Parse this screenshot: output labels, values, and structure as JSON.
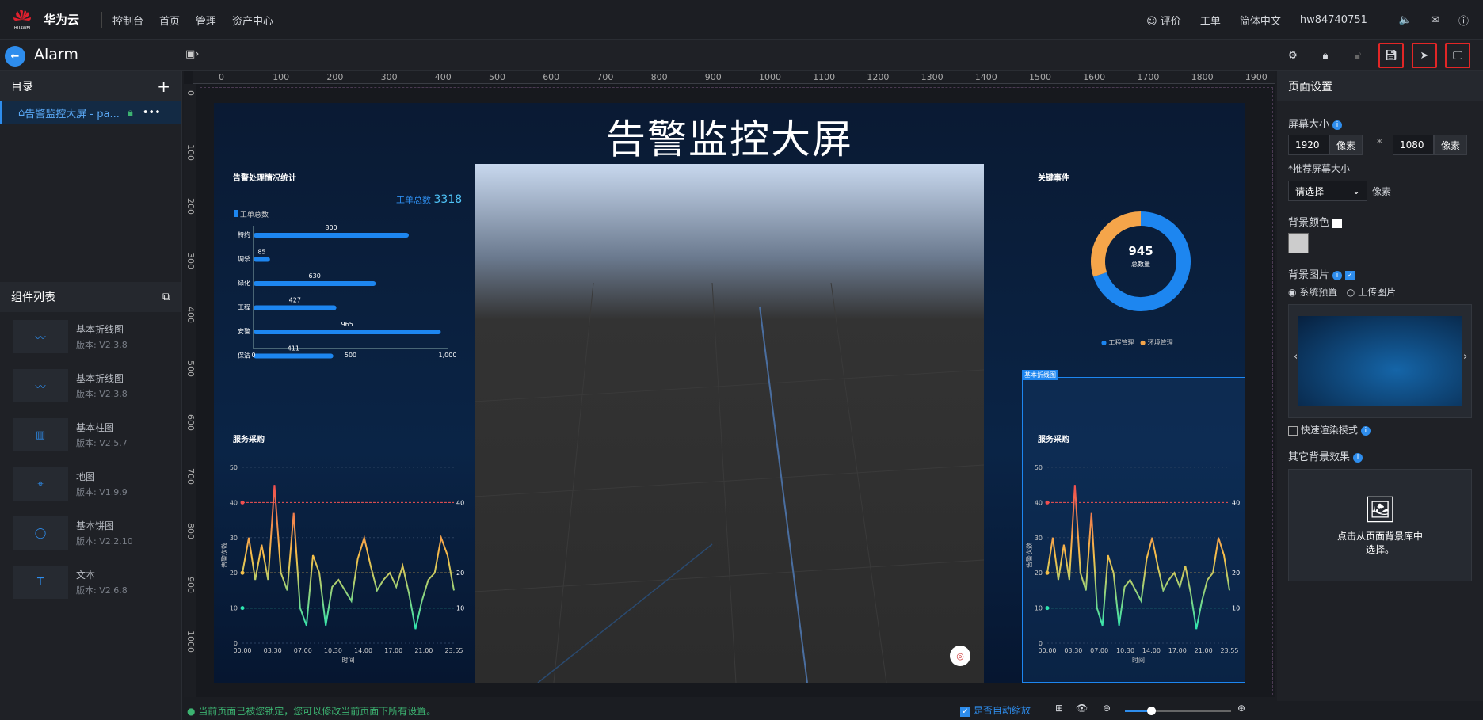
{
  "topbar": {
    "brand": "华为云",
    "nav": [
      "控制台",
      "首页",
      "管理",
      "资产中心"
    ],
    "feedback": "评价",
    "ticket": "工单",
    "language": "简体中文",
    "user": "hw84740751"
  },
  "secbar": {
    "title": "Alarm"
  },
  "left": {
    "catalog_title": "目录",
    "page_item": "告警监控大屏 - pa...",
    "components_title": "组件列表",
    "components": [
      {
        "name": "基本折线图",
        "version": "版本: V2.3.8",
        "icon": "line-chart-icon"
      },
      {
        "name": "基本折线图",
        "version": "版本: V2.3.8",
        "icon": "line-chart-icon"
      },
      {
        "name": "基本柱图",
        "version": "版本: V2.5.7",
        "icon": "bar-chart-icon"
      },
      {
        "name": "地图",
        "version": "版本: V1.9.9",
        "icon": "map-icon"
      },
      {
        "name": "基本饼图",
        "version": "版本: V2.2.10",
        "icon": "pie-chart-icon"
      },
      {
        "name": "文本",
        "version": "版本: V2.6.8",
        "icon": "text-icon"
      }
    ]
  },
  "ruler": {
    "h": [
      "0",
      "100",
      "200",
      "300",
      "400",
      "500",
      "600",
      "700",
      "800",
      "900",
      "1000",
      "1100",
      "1200",
      "1300",
      "1400",
      "1500",
      "1600",
      "1700",
      "1800",
      "1900"
    ],
    "v": [
      "0",
      "100",
      "200",
      "300",
      "400",
      "500",
      "600",
      "700",
      "800",
      "900",
      "1000"
    ]
  },
  "stage": {
    "title": "告警监控大屏",
    "bar_title": "告警处理情况统计",
    "total_label": "工单总数",
    "total_value": "3318",
    "legend": "工单总数",
    "key_events": "关键事件",
    "donut_value": "945",
    "donut_label": "总数量",
    "donut_legend": [
      "工程管理",
      "环境管理"
    ],
    "service_title": "服务采购",
    "service_title2": "服务采购",
    "line_ylabel": "告警次数",
    "line_xlabel": "时间",
    "selected_tag": "基本折线图"
  },
  "chart_data": [
    {
      "type": "bar",
      "title": "告警处理情况统计",
      "categories": [
        "特约",
        "调杀",
        "绿化",
        "工程",
        "安警",
        "保洁"
      ],
      "series": [
        {
          "name": "工单总数",
          "values": [
            800,
            85,
            630,
            427,
            965,
            411
          ]
        }
      ],
      "xlim": [
        0,
        1000
      ],
      "xticks": [
        "0",
        "500",
        "1,000"
      ]
    },
    {
      "type": "pie",
      "title": "关键事件",
      "slices": [
        {
          "name": "工程管理",
          "value": 0.7
        },
        {
          "name": "环境管理",
          "value": 0.3
        }
      ],
      "colors": [
        "#1d86f0",
        "#f5a54a"
      ]
    },
    {
      "type": "line",
      "title": "服务采购",
      "ylim": [
        0,
        50
      ],
      "yticks": [
        "0",
        "10",
        "20",
        "30",
        "40",
        "50"
      ],
      "x": [
        "00:00",
        "03:30",
        "07:00",
        "10:30",
        "14:00",
        "17:00",
        "21:00",
        "23:55"
      ],
      "values": [
        20,
        30,
        18,
        28,
        18,
        45,
        20,
        15,
        37,
        10,
        5,
        25,
        20,
        5,
        16,
        18,
        15,
        12,
        24,
        30,
        22,
        15,
        18,
        20,
        16,
        22,
        14,
        4,
        12,
        18,
        20,
        30,
        25,
        15
      ],
      "markers": [
        "40",
        "20",
        "10"
      ]
    }
  ],
  "right": {
    "section": "页面设置",
    "screen_size": "屏幕大小",
    "width": "1920",
    "height": "1080",
    "unit": "像素",
    "recommend": "*推荐屏幕大小",
    "select": "请选择",
    "bg_color": "背景颜色",
    "bg_image": "背景图片",
    "preset": "系统预置",
    "upload": "上传图片",
    "fast_render": "快速渲染模式",
    "other_bg": "其它背景效果",
    "pick_hint": "点击从页面背景库中选择。"
  },
  "status": {
    "locked": "当前页面已被您锁定，您可以修改当前页面下所有设置。",
    "auto_zoom": "是否自动缩放"
  }
}
